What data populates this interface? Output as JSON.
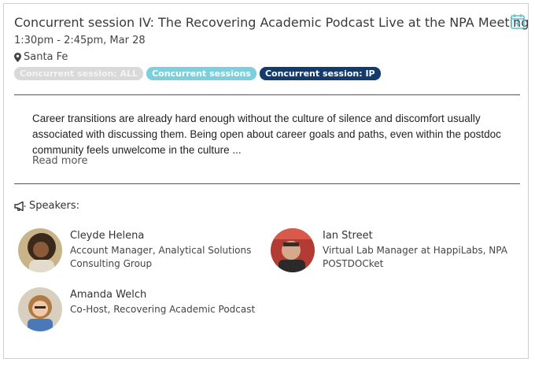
{
  "session": {
    "title": "Concurrent session IV: The Recovering Academic Podcast Live at the NPA Meeting",
    "time": "1:30pm - 2:45pm, Mar 28",
    "location": "Santa Fe",
    "tags": [
      "Concurrent session: ALL",
      "Concurrent sessions",
      "Concurrent session: IP"
    ],
    "tag_colors": [
      "#d9d9d9",
      "#7ccfdc",
      "#143b6b"
    ],
    "description": "Career transitions are already hard enough without the culture of silence and discomfort usually associated with discussing them. Being open about career goals and paths, even within the postdoc community feels unwelcome in the culture ...",
    "read_more": "Read more",
    "calendar_icon": "calendar-add-icon",
    "location_icon": "map-marker-icon"
  },
  "speakers": {
    "heading": "Speakers:",
    "heading_icon": "bullhorn-icon",
    "list": [
      {
        "name": "Cleyde Helena",
        "role": "Account Manager, Analytical Solutions Consulting Group"
      },
      {
        "name": "Ian Street",
        "role": "Virtual Lab Manager at HappiLabs, NPA POSTDOCket"
      },
      {
        "name": "Amanda Welch",
        "role": "Co-Host, Recovering Academic Podcast"
      }
    ]
  }
}
